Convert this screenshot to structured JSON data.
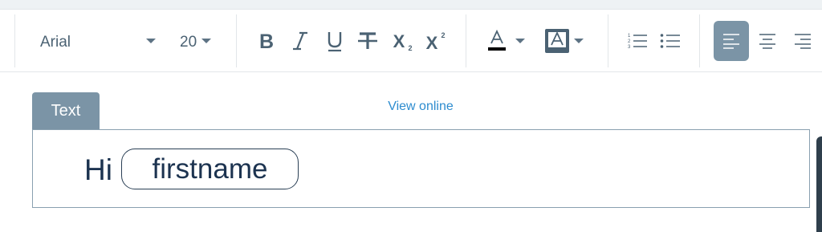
{
  "toolbar": {
    "font_family": "Arial",
    "font_size": "20",
    "format_buttons": [
      {
        "name": "bold-button",
        "icon": "bold-icon"
      },
      {
        "name": "italic-button",
        "icon": "italic-icon"
      },
      {
        "name": "underline-button",
        "icon": "underline-icon"
      },
      {
        "name": "strikethrough-button",
        "icon": "strikethrough-icon"
      },
      {
        "name": "subscript-button",
        "icon": "subscript-icon"
      },
      {
        "name": "superscript-button",
        "icon": "superscript-icon"
      }
    ],
    "text_color": "#000000",
    "highlight_color": "#7b94a6",
    "align_left_active": true
  },
  "tab": {
    "label": "Text"
  },
  "view_online": "View online",
  "editor": {
    "greeting": "Hi",
    "token": "firstname"
  },
  "colors": {
    "accent": "#7b94a6",
    "link": "#2d8ccf",
    "text": "#1c3350",
    "icon": "#4b6273"
  }
}
